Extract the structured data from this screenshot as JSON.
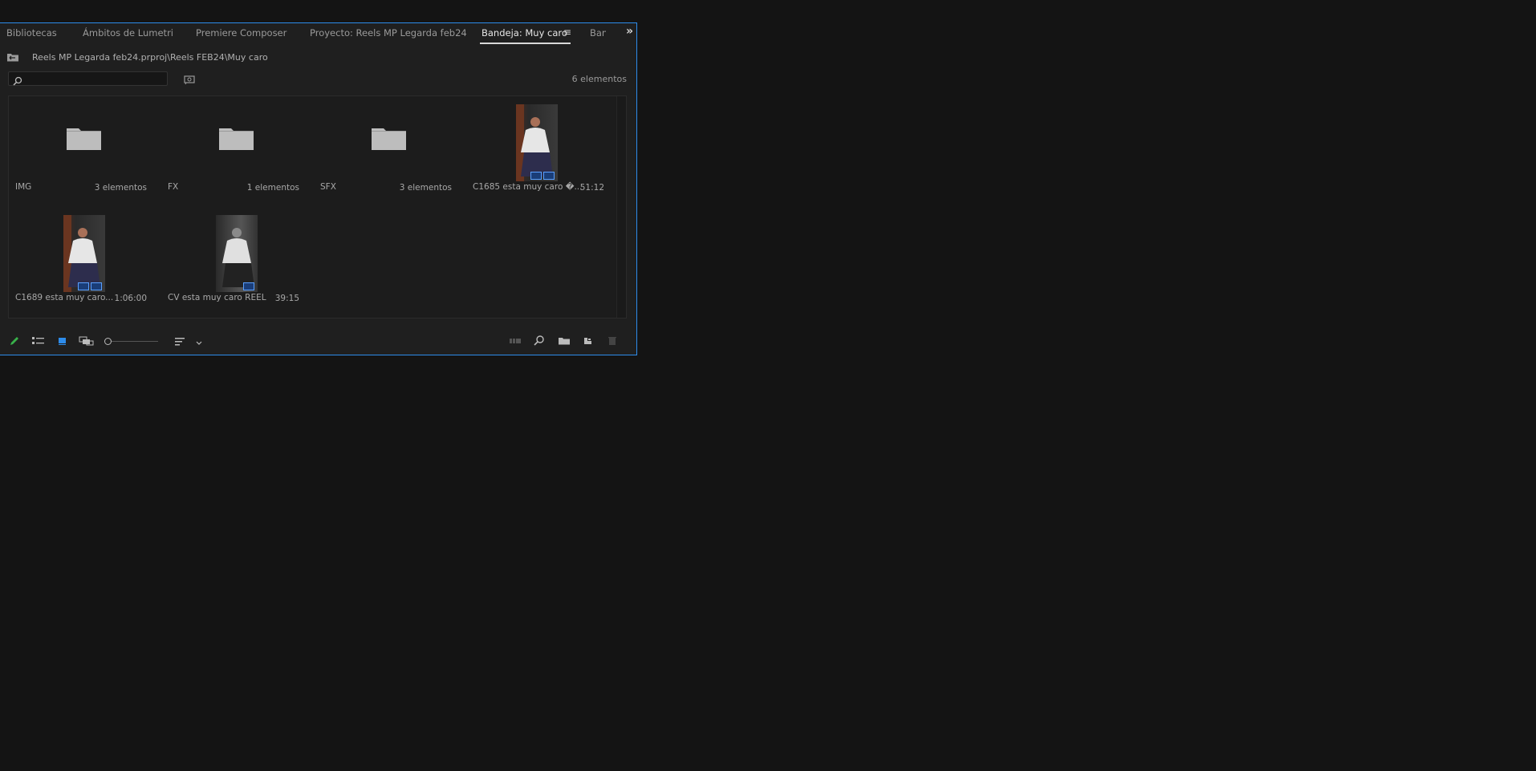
{
  "tabs": [
    {
      "label": "Bibliotecas"
    },
    {
      "label": "Ámbitos de Lumetri"
    },
    {
      "label": "Premiere Composer"
    },
    {
      "label": "Proyecto: Reels MP Legarda feb24"
    },
    {
      "label": "Bandeja: Muy caro",
      "active": true
    },
    {
      "label": "Ban"
    }
  ],
  "path": "Reels MP Legarda feb24.prproj\\Reels FEB24\\Muy caro",
  "search": {
    "value": "",
    "placeholder": ""
  },
  "item_count": "6 elementos",
  "items": [
    {
      "name": "IMG",
      "meta": "3 elementos",
      "kind": "folder"
    },
    {
      "name": "FX",
      "meta": "1 elementos",
      "kind": "folder"
    },
    {
      "name": "SFX",
      "meta": "3 elementos",
      "kind": "folder"
    },
    {
      "name": "C1685 esta muy caro �...",
      "meta": "51:12",
      "kind": "clip"
    },
    {
      "name": "C1689 esta muy caro...",
      "meta": "1:06:00",
      "kind": "clip"
    },
    {
      "name": "CV esta muy caro REEL",
      "meta": "39:15",
      "kind": "sequence"
    }
  ],
  "colors": {
    "accent": "#2d8ceb",
    "pencil": "#38b24a",
    "panel_bg": "#1f1f1f"
  },
  "icons": {
    "toolbar_left": [
      "pencil-icon",
      "list-view-icon",
      "icon-view-icon",
      "freeform-view-icon",
      "zoom-slider",
      "sort-icon"
    ],
    "toolbar_right": [
      "automate-sequence-icon",
      "find-icon",
      "new-bin-icon",
      "new-item-icon",
      "clear-icon"
    ]
  }
}
